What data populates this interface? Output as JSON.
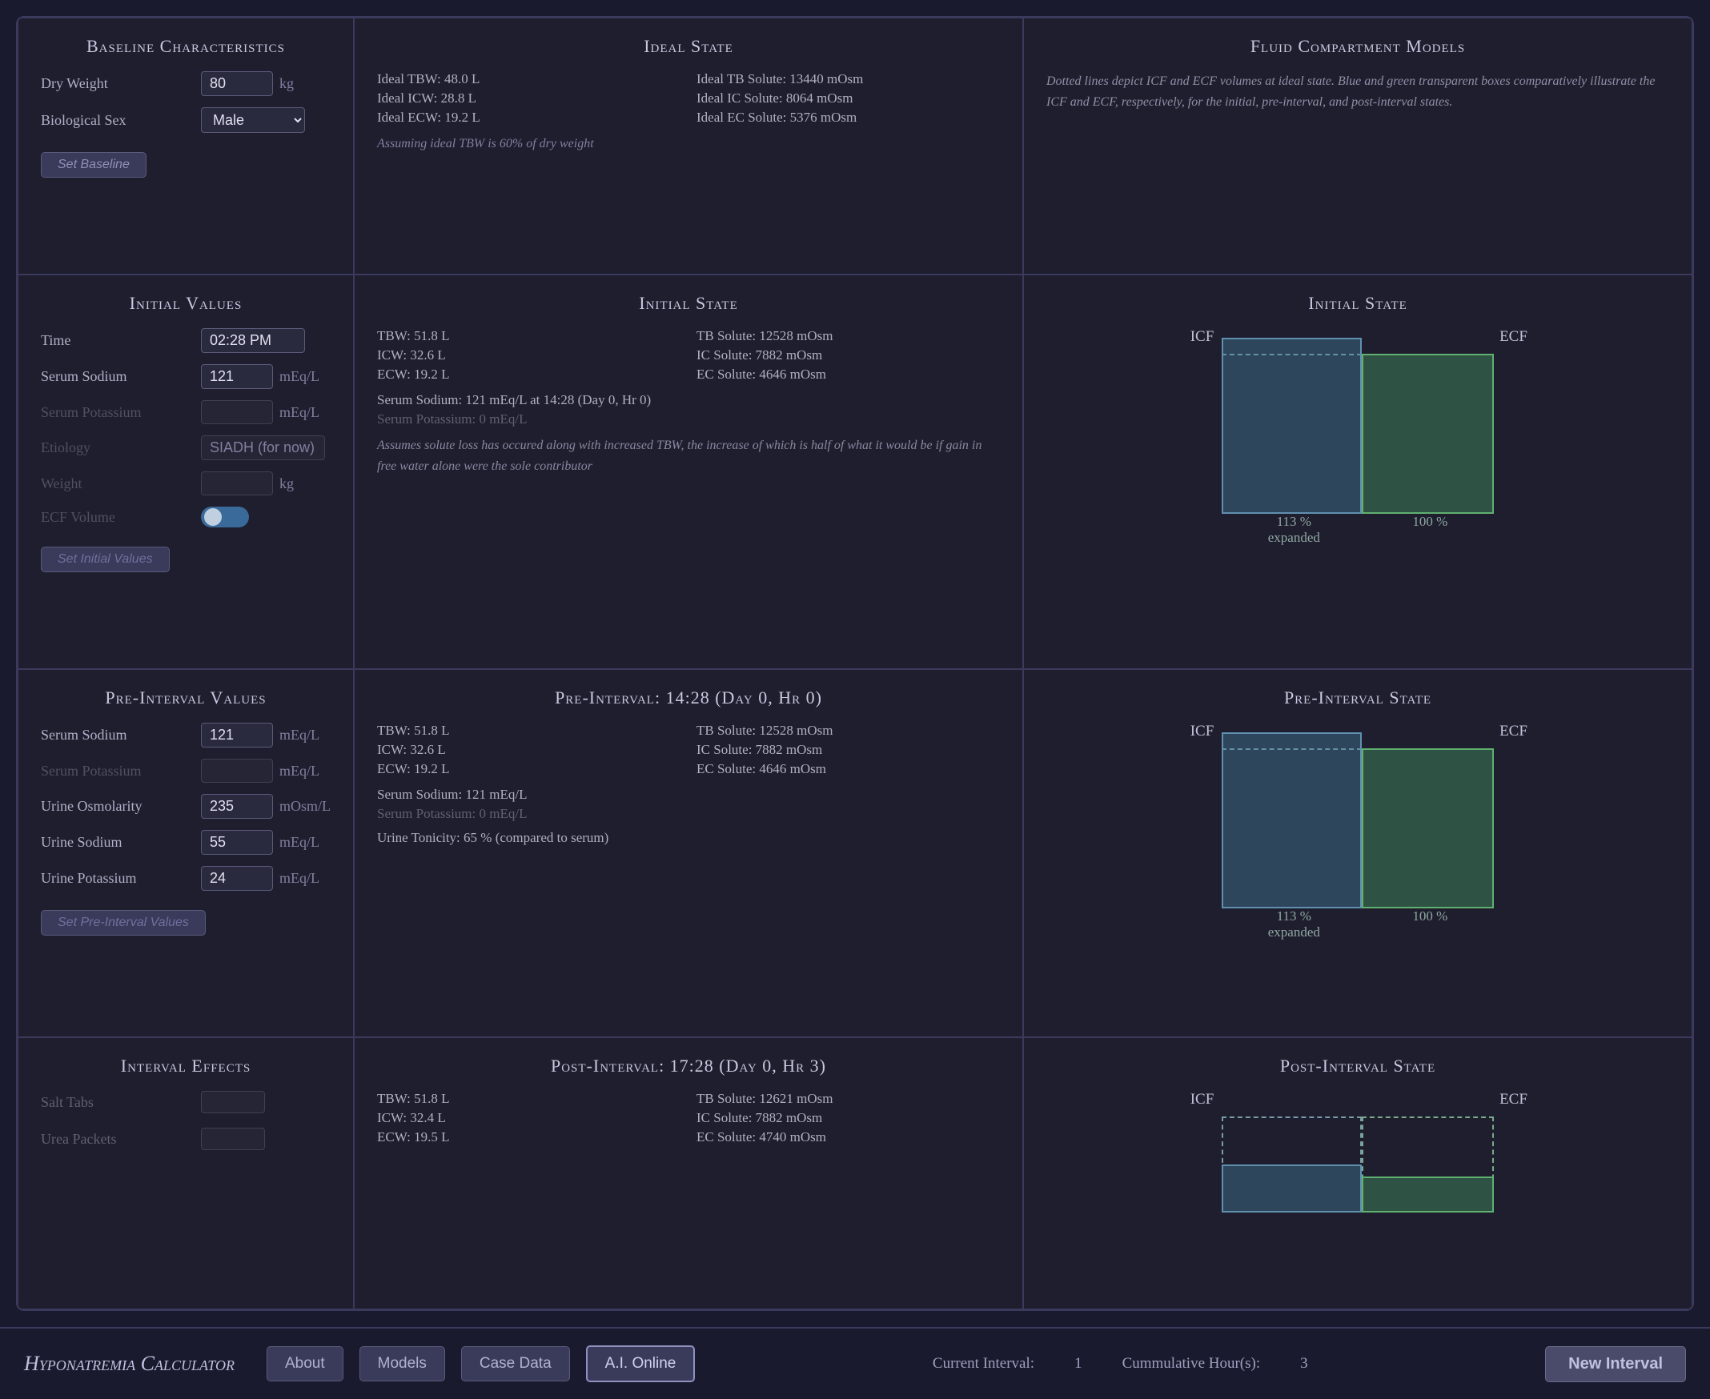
{
  "app": {
    "title": "Hyponatremia Calculator",
    "nav": {
      "about": "About",
      "models": "Models",
      "case_data": "Case Data",
      "ai_online": "A.I. Online"
    },
    "status": {
      "current_interval_label": "Current Interval:",
      "current_interval_value": "1",
      "cumulative_hours_label": "Cummulative Hour(s):",
      "cumulative_hours_value": "3"
    },
    "new_interval": "New Interval"
  },
  "baseline": {
    "title": "Baseline Characteristics",
    "dry_weight_label": "Dry Weight",
    "dry_weight_value": "80",
    "dry_weight_unit": "kg",
    "biological_sex_label": "Biological Sex",
    "biological_sex_value": "Male",
    "set_btn": "Set Baseline"
  },
  "ideal_state": {
    "title": "Ideal State",
    "tbw": "Ideal TBW:  48.0 L",
    "icw": "Ideal ICW:  28.8 L",
    "ecw": "Ideal ECW:  19.2 L",
    "tb_solute": "Ideal TB Solute:  13440 mOsm",
    "ic_solute": "Ideal IC Solute:  8064 mOsm",
    "ec_solute": "Ideal EC Solute:  5376 mOsm",
    "note": "Assuming ideal TBW is 60% of dry weight"
  },
  "fluid_compartment": {
    "title": "Fluid Compartment Models",
    "description": "Dotted lines depict ICF and ECF volumes at ideal state. Blue and green transparent boxes comparatively illustrate the ICF and ECF, respectively, for the initial, pre-interval, and post-interval states."
  },
  "initial_values": {
    "title": "Initial Values",
    "time_label": "Time",
    "time_value": "02:28 PM",
    "serum_sodium_label": "Serum Sodium",
    "serum_sodium_value": "121",
    "serum_sodium_unit": "mEq/L",
    "serum_potassium_label": "Serum Potassium",
    "serum_potassium_unit": "mEq/L",
    "etiology_label": "Etiology",
    "etiology_value": "SIADH (for now)",
    "weight_label": "Weight",
    "weight_unit": "kg",
    "ecf_volume_label": "ECF Volume",
    "set_btn": "Set Initial Values"
  },
  "initial_state": {
    "title": "Initial State",
    "tbw": "TBW:  51.8 L",
    "icw": "ICW:  32.6 L",
    "ecw": "ECW:  19.2 L",
    "tb_solute": "TB Solute:  12528 mOsm",
    "ic_solute": "IC Solute:  7882 mOsm",
    "ec_solute": "EC Solute:  4646 mOsm",
    "serum_sodium": "Serum Sodium:  121 mEq/L at 14:28 (Day 0, Hr 0)",
    "serum_potassium": "Serum Potassium:  0 mEq/L",
    "note": "Assumes solute loss has occured along with increased TBW, the increase of which is half of what it would be if gain in free water alone were the sole contributor",
    "icf_label": "ICF",
    "ecf_label": "ECF",
    "icf_pct": "113 %",
    "icf_pct_label": "expanded",
    "ecf_pct": "100 %"
  },
  "pre_interval_values": {
    "title": "Pre-Interval Values",
    "serum_sodium_label": "Serum Sodium",
    "serum_sodium_value": "121",
    "serum_sodium_unit": "mEq/L",
    "serum_potassium_label": "Serum Potassium",
    "serum_potassium_unit": "mEq/L",
    "urine_osmolarity_label": "Urine Osmolarity",
    "urine_osmolarity_value": "235",
    "urine_osmolarity_unit": "mOsm/L",
    "urine_sodium_label": "Urine Sodium",
    "urine_sodium_value": "55",
    "urine_sodium_unit": "mEq/L",
    "urine_potassium_label": "Urine Potassium",
    "urine_potassium_value": "24",
    "urine_potassium_unit": "mEq/L",
    "set_btn": "Set Pre-Interval Values"
  },
  "pre_interval_state": {
    "title": "Pre-Interval: 14:28 (Day 0, Hr 0)",
    "tbw": "TBW:  51.8 L",
    "icw": "ICW:  32.6 L",
    "ecw": "ECW:  19.2 L",
    "tb_solute": "TB Solute:  12528 mOsm",
    "ic_solute": "IC Solute:  7882 mOsm",
    "ec_solute": "EC Solute:  4646 mOsm",
    "serum_sodium": "Serum Sodium:  121 mEq/L",
    "serum_potassium": "Serum Potassium:  0 mEq/L",
    "urine_tonicity": "Urine Tonicity:  65 %   (compared to serum)",
    "icf_label": "ICF",
    "ecf_label": "ECF",
    "icf_pct": "113 %",
    "icf_pct_label": "expanded",
    "ecf_pct": "100 %",
    "state_title": "Pre-Interval State"
  },
  "interval_effects": {
    "title": "Interval Effects",
    "salt_tabs_label": "Salt Tabs",
    "urea_packets_label": "Urea Packets"
  },
  "post_interval_state": {
    "title": "Post-Interval: 17:28 (Day 0, Hr 3)",
    "tbw": "TBW:  51.8 L",
    "icw": "ICW:  32.4 L",
    "ecw": "ECW:  19.5 L",
    "tb_solute": "TB Solute:  12621 mOsm",
    "ic_solute": "IC Solute:  7882 mOsm",
    "ec_solute": "EC Solute:  4740 mOsm",
    "post_state_title": "Post-Interval State",
    "icf_label": "ICF",
    "ecf_label": "ECF"
  }
}
